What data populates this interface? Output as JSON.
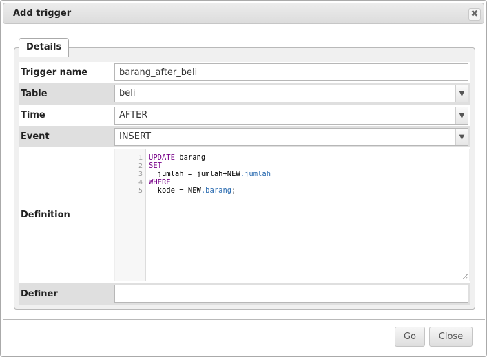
{
  "dialog": {
    "title": "Add trigger",
    "close_glyph": "✖"
  },
  "fieldset": {
    "legend": "Details"
  },
  "form": {
    "trigger_name": {
      "label": "Trigger name",
      "value": "barang_after_beli"
    },
    "table": {
      "label": "Table",
      "value": "beli"
    },
    "time": {
      "label": "Time",
      "value": "AFTER"
    },
    "event": {
      "label": "Event",
      "value": "INSERT"
    },
    "definition": {
      "label": "Definition",
      "line_numbers": [
        "1",
        "2",
        "3",
        "4",
        "5"
      ],
      "lines": [
        [
          {
            "t": "UPDATE",
            "c": "kw"
          },
          {
            "t": " barang",
            "c": ""
          }
        ],
        [
          {
            "t": "SET",
            "c": "kw"
          }
        ],
        [
          {
            "t": "  jumlah = jumlah+NEW",
            "c": ""
          },
          {
            "t": ".jumlah",
            "c": "prop"
          }
        ],
        [
          {
            "t": "WHERE",
            "c": "kw"
          }
        ],
        [
          {
            "t": "  kode = NEW",
            "c": ""
          },
          {
            "t": ".barang",
            "c": "prop"
          },
          {
            "t": ";",
            "c": ""
          }
        ]
      ]
    },
    "definer": {
      "label": "Definer",
      "value": ""
    }
  },
  "footer": {
    "go_label": "Go",
    "close_label": "Close"
  },
  "icons": {
    "close": "close-icon",
    "dropdown": "chevron-down-icon"
  }
}
